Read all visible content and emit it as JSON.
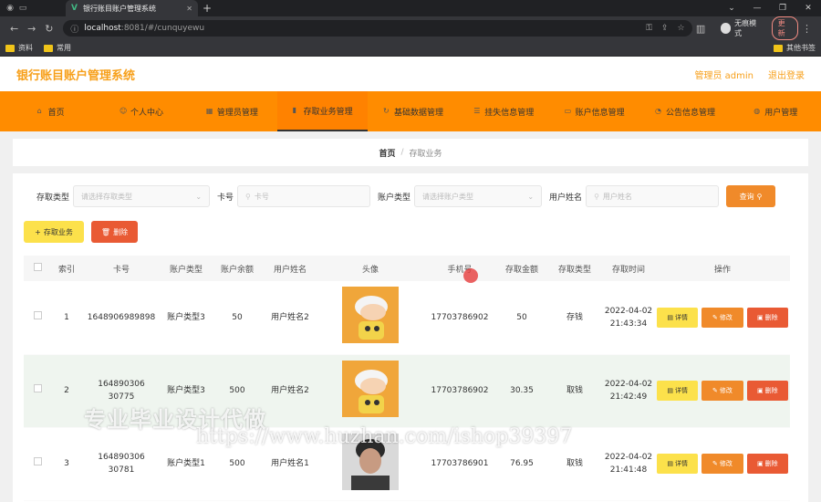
{
  "browser": {
    "tab_title": "银行账目账户管理系统",
    "url_host": "localhost",
    "url_path": ":8081/#/cunquyewu",
    "profile_name": "无痕模式",
    "update_label": "更新",
    "bookmarks": [
      "资料",
      "常用"
    ],
    "bookmarks_right": "其他书签"
  },
  "header": {
    "title": "银行账目账户管理系统",
    "admin_label": "管理员 admin",
    "logout_label": "退出登录"
  },
  "menu": [
    {
      "label": "首页"
    },
    {
      "label": "个人中心"
    },
    {
      "label": "管理员管理"
    },
    {
      "label": "存取业务管理"
    },
    {
      "label": "基础数据管理"
    },
    {
      "label": "挂失信息管理"
    },
    {
      "label": "账户信息管理"
    },
    {
      "label": "公告信息管理"
    },
    {
      "label": "用户管理"
    }
  ],
  "breadcrumb": {
    "home": "首页",
    "current": "存取业务"
  },
  "search": {
    "type_label": "存取类型",
    "type_placeholder": "请选择存取类型",
    "card_label": "卡号",
    "card_placeholder": "卡号",
    "acct_label": "账户类型",
    "acct_placeholder": "请选择账户类型",
    "name_label": "用户姓名",
    "name_placeholder": "用户姓名",
    "query_label": "查询"
  },
  "toolbar": {
    "add_label": "存取业务",
    "delete_label": "删除"
  },
  "table": {
    "columns": [
      "索引",
      "卡号",
      "账户类型",
      "账户余额",
      "用户姓名",
      "头像",
      "手机号",
      "存取金额",
      "存取类型",
      "存取时间",
      "操作"
    ],
    "rows": [
      {
        "index": "1",
        "card": "1648906989898",
        "acct_type": "账户类型3",
        "balance": "50",
        "name": "用户姓名2",
        "phone": "17703786902",
        "amount": "50",
        "op_type": "存钱",
        "time": "2022-04-02 21:43:34"
      },
      {
        "index": "2",
        "card": "164890306 30775",
        "acct_type": "账户类型3",
        "balance": "500",
        "name": "用户姓名2",
        "phone": "17703786902",
        "amount": "30.35",
        "op_type": "取钱",
        "time": "2022-04-02 21:42:49"
      },
      {
        "index": "3",
        "card": "164890306 30781",
        "acct_type": "账户类型1",
        "balance": "500",
        "name": "用户姓名1",
        "phone": "17703786901",
        "amount": "76.95",
        "op_type": "取钱",
        "time": "2022-04-02 21:41:48"
      }
    ],
    "btn_detail": "详情",
    "btn_edit": "修改",
    "btn_delete": "删除"
  },
  "watermark": {
    "line1": "专业毕业设计代做",
    "line2": "https://www.huzhan.com/ishop39397"
  }
}
